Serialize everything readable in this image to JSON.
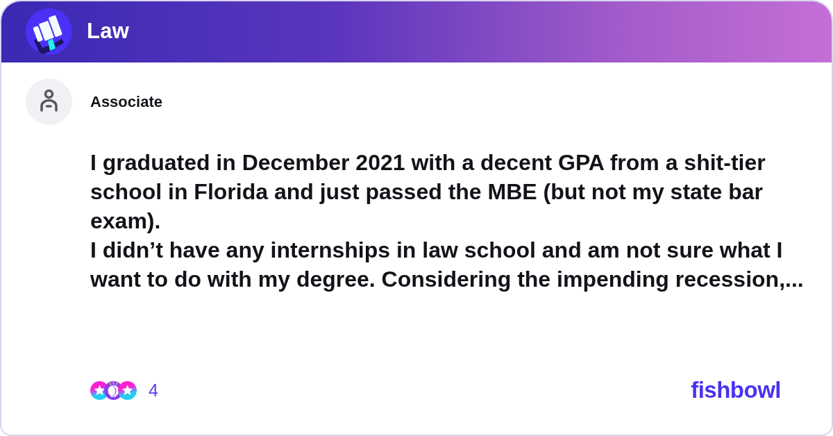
{
  "header": {
    "title": "Law"
  },
  "post": {
    "author": "Associate",
    "paragraphs": [
      "I graduated in December 2021 with a decent GPA from a shit-tier school in Florida and just passed the MBE (but not my state bar exam).",
      "I didn’t have any internships in law school and am not sure what I want to do with my degree. Considering the impending recession,..."
    ]
  },
  "footer": {
    "reaction_count": "4",
    "brand": "fishbowl"
  }
}
